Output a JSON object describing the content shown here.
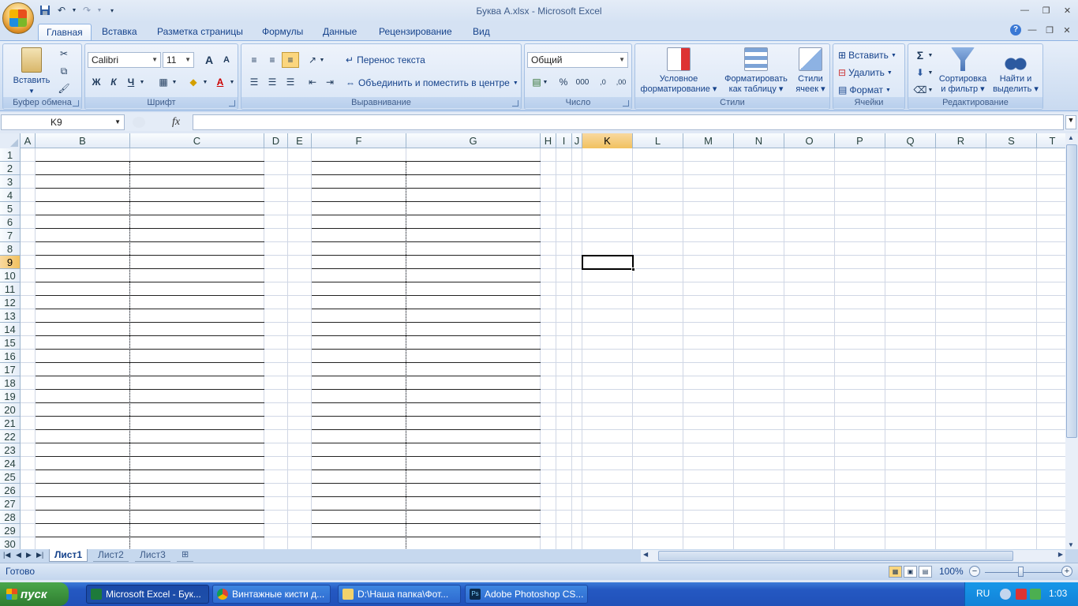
{
  "window": {
    "title": "Буква А.xlsx - Microsoft Excel"
  },
  "qat": {
    "save_icon": "save-icon",
    "undo_icon": "undo-icon",
    "redo_icon": "redo-icon",
    "customize_icon": "customize-icon"
  },
  "ribbon_tabs": [
    "Главная",
    "Вставка",
    "Разметка страницы",
    "Формулы",
    "Данные",
    "Рецензирование",
    "Вид"
  ],
  "ribbon": {
    "clipboard": {
      "paste": "Вставить",
      "label": "Буфер обмена"
    },
    "font": {
      "name": "Calibri",
      "size": "11",
      "bold": "Ж",
      "italic": "К",
      "underline": "Ч",
      "grow": "A",
      "shrink": "A",
      "label": "Шрифт"
    },
    "alignment": {
      "wrap": "Перенос текста",
      "merge": "Объединить и поместить в центре",
      "label": "Выравнивание"
    },
    "number": {
      "format": "Общий",
      "percent": "%",
      "thousands": "000",
      "inc_decimal": ",0",
      "dec_decimal": ",00",
      "label": "Число"
    },
    "styles": {
      "conditional_line1": "Условное",
      "conditional_line2": "форматирование",
      "table_line1": "Форматировать",
      "table_line2": "как таблицу",
      "cell_line1": "Стили",
      "cell_line2": "ячеек",
      "label": "Стили"
    },
    "cells": {
      "insert": "Вставить",
      "delete": "Удалить",
      "format": "Формат",
      "label": "Ячейки"
    },
    "editing": {
      "sigma": "Σ",
      "sort_line1": "Сортировка",
      "sort_line2": "и фильтр",
      "find_line1": "Найти и",
      "find_line2": "выделить",
      "label": "Редактирование"
    }
  },
  "formula_bar": {
    "name_box": "K9",
    "fx": "fx",
    "value": ""
  },
  "grid": {
    "columns": [
      "A",
      "B",
      "C",
      "D",
      "E",
      "F",
      "G",
      "H",
      "I",
      "J",
      "K",
      "L",
      "M",
      "N",
      "O",
      "P",
      "Q",
      "R",
      "S",
      "T"
    ],
    "rows": [
      "1",
      "2",
      "3",
      "4",
      "5",
      "6",
      "7",
      "8",
      "9",
      "10",
      "11",
      "12",
      "13",
      "14",
      "15",
      "16",
      "17",
      "18",
      "19",
      "20",
      "21",
      "22",
      "23",
      "24",
      "25",
      "26",
      "27",
      "28",
      "29",
      "30"
    ],
    "selected_cell": "K9"
  },
  "sheets": [
    "Лист1",
    "Лист2",
    "Лист3"
  ],
  "status": {
    "text": "Готово",
    "zoom": "100%",
    "zoom_minus": "−",
    "zoom_plus": "+"
  },
  "taskbar": {
    "start": "пуск",
    "tasks": [
      "Microsoft Excel - Бук...",
      "Винтажные кисти д...",
      "D:\\Наша папка\\Фот...",
      "Adobe Photoshop CS..."
    ],
    "lang": "RU",
    "clock": "1:03"
  },
  "colors": {
    "selected_header": "#f1c15f",
    "ribbon_bg": "#dfe8f5",
    "taskbar": "#2458c2",
    "start": "#3c923d"
  }
}
